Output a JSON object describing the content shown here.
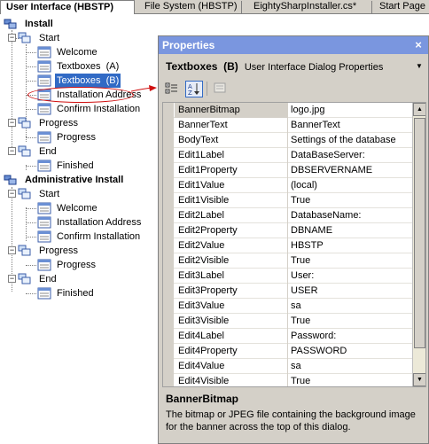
{
  "tabs": [
    {
      "label": "User Interface (HBSTP)",
      "active": true
    },
    {
      "label": "File System (HBSTP)",
      "active": false
    },
    {
      "label": "EightySharpInstaller.cs*",
      "active": false
    },
    {
      "label": "Start Page",
      "active": false
    }
  ],
  "tree": {
    "install": {
      "label": "Install",
      "start": {
        "label": "Start",
        "items": [
          "Welcome",
          "Textboxes  (A)",
          "Textboxes  (B)",
          "Installation Address",
          "Confirm Installation"
        ]
      },
      "progress": {
        "label": "Progress",
        "items": [
          "Progress"
        ]
      },
      "end": {
        "label": "End",
        "items": [
          "Finished"
        ]
      }
    },
    "admin": {
      "label": "Administrative Install",
      "start": {
        "label": "Start",
        "items": [
          "Welcome",
          "Installation Address",
          "Confirm Installation"
        ]
      },
      "progress": {
        "label": "Progress",
        "items": [
          "Progress"
        ]
      },
      "end": {
        "label": "End",
        "items": [
          "Finished"
        ]
      }
    }
  },
  "properties": {
    "title": "Properties",
    "object_name": "Textboxes  (B)",
    "object_type": "User Interface Dialog Properties",
    "rows": [
      {
        "name": "BannerBitmap",
        "value": "logo.jpg"
      },
      {
        "name": "BannerText",
        "value": "BannerText"
      },
      {
        "name": "BodyText",
        "value": "Settings of the database"
      },
      {
        "name": "Edit1Label",
        "value": "DataBaseServer:"
      },
      {
        "name": "Edit1Property",
        "value": "DBSERVERNAME"
      },
      {
        "name": "Edit1Value",
        "value": "(local)"
      },
      {
        "name": "Edit1Visible",
        "value": "True"
      },
      {
        "name": "Edit2Label",
        "value": "DatabaseName:"
      },
      {
        "name": "Edit2Property",
        "value": "DBNAME"
      },
      {
        "name": "Edit2Value",
        "value": "HBSTP"
      },
      {
        "name": "Edit2Visible",
        "value": "True"
      },
      {
        "name": "Edit3Label",
        "value": "User:"
      },
      {
        "name": "Edit3Property",
        "value": "USER"
      },
      {
        "name": "Edit3Value",
        "value": "sa"
      },
      {
        "name": "Edit3Visible",
        "value": "True"
      },
      {
        "name": "Edit4Label",
        "value": "Password:"
      },
      {
        "name": "Edit4Property",
        "value": "PASSWORD"
      },
      {
        "name": "Edit4Value",
        "value": "sa"
      },
      {
        "name": "Edit4Visible",
        "value": "True"
      }
    ],
    "description_title": "BannerBitmap",
    "description_text": "The bitmap or JPEG file containing the background image for the banner across the top of this dialog."
  },
  "colors": {
    "selection": "#316ac5",
    "title_bar": "#7a96df",
    "annotation": "#d01010",
    "chrome": "#d4d0c8"
  }
}
